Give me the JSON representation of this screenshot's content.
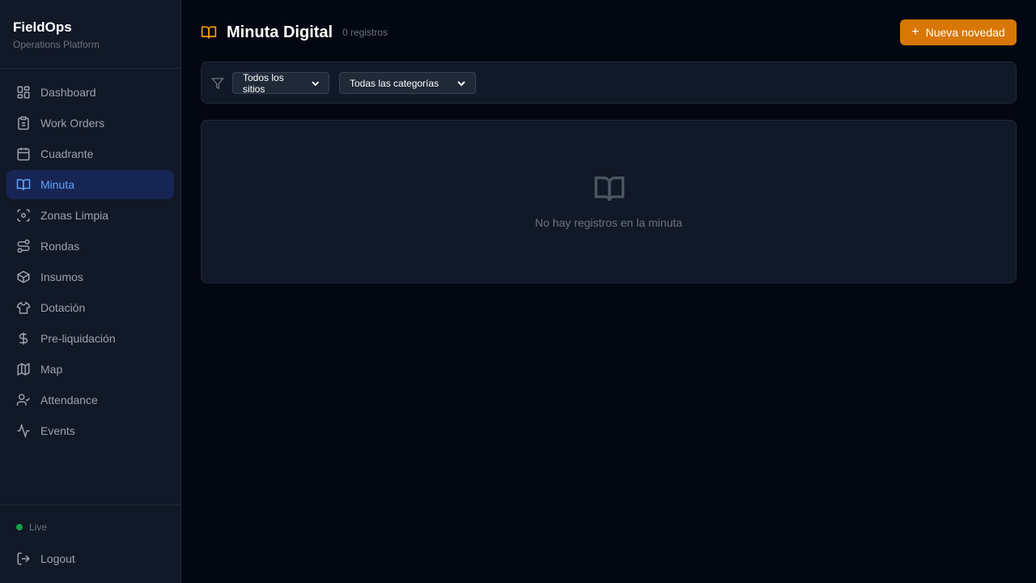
{
  "brand": {
    "title": "FieldOps",
    "subtitle": "Operations Platform"
  },
  "sidebar": {
    "items": [
      {
        "label": "Dashboard",
        "icon": "dashboard-icon"
      },
      {
        "label": "Work Orders",
        "icon": "clipboard-icon"
      },
      {
        "label": "Cuadrante",
        "icon": "calendar-icon"
      },
      {
        "label": "Minuta",
        "icon": "book-icon",
        "active": true
      },
      {
        "label": "Zonas Limpia",
        "icon": "scan-icon"
      },
      {
        "label": "Rondas",
        "icon": "route-icon"
      },
      {
        "label": "Insumos",
        "icon": "package-icon"
      },
      {
        "label": "Dotación",
        "icon": "shirt-icon"
      },
      {
        "label": "Pre-liquidación",
        "icon": "dollar-icon"
      },
      {
        "label": "Map",
        "icon": "map-icon"
      },
      {
        "label": "Attendance",
        "icon": "user-check-icon"
      },
      {
        "label": "Events",
        "icon": "activity-icon"
      }
    ],
    "status": "Live",
    "logout": "Logout"
  },
  "header": {
    "title": "Minuta Digital",
    "count": "0 registros",
    "new_button": "Nueva novedad"
  },
  "filters": {
    "site": "Todos los sitios",
    "category": "Todas las categorías"
  },
  "empty": {
    "message": "No hay registros en la minuta"
  },
  "colors": {
    "accent": "#d97706",
    "active_nav_bg": "#172554",
    "active_nav_text": "#60a5fa",
    "live": "#16a34a"
  }
}
